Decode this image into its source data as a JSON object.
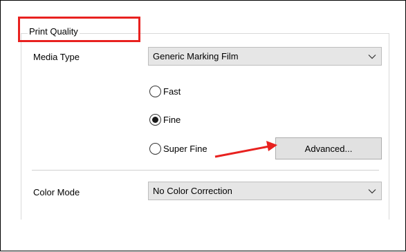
{
  "print_quality": {
    "group_title": "Print Quality",
    "media_type_label": "Media Type",
    "media_type_value": "Generic Marking Film",
    "quality_options": [
      {
        "label": "Fast",
        "selected": false
      },
      {
        "label": "Fine",
        "selected": true
      },
      {
        "label": "Super Fine",
        "selected": false
      }
    ],
    "advanced_button_label": "Advanced...",
    "color_mode_label": "Color Mode",
    "color_mode_value": "No Color Correction"
  },
  "annotations": {
    "highlight_color": "#e8211f",
    "arrow_color": "#e8211f"
  },
  "icons": {
    "dropdown": "chevron-down-icon"
  }
}
